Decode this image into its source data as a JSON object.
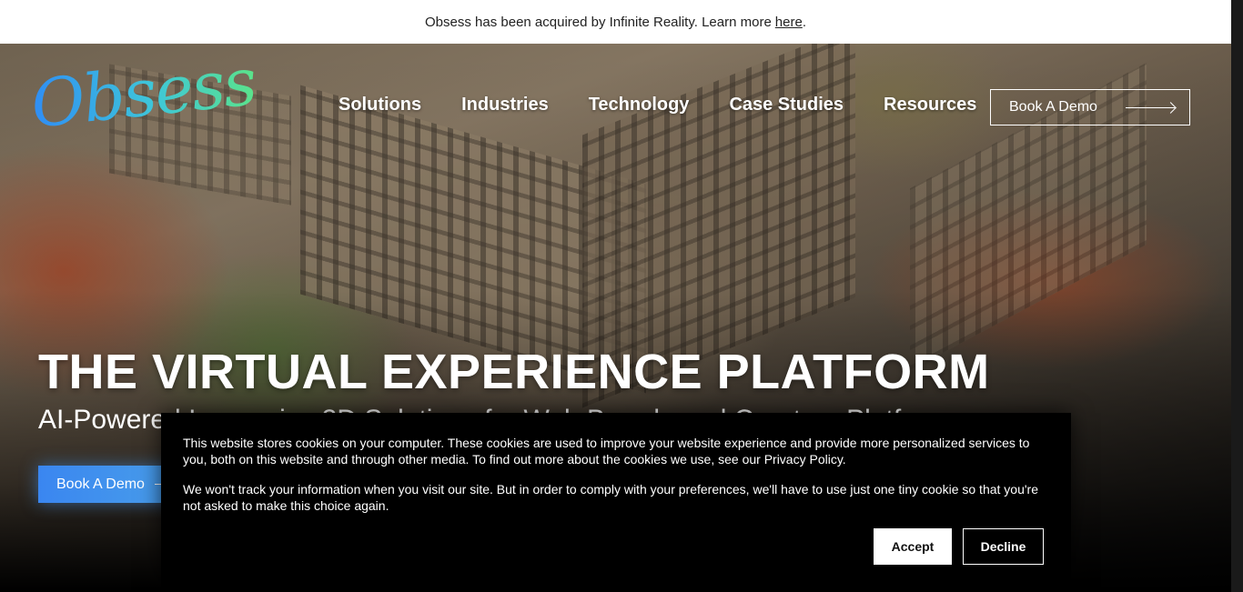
{
  "announcement": {
    "text": "Obsess has been acquired by Infinite Reality. Learn more",
    "link": "here",
    "suffix": "."
  },
  "header": {
    "logo": "Obsess",
    "nav": [
      "Solutions",
      "Industries",
      "Technology",
      "Case Studies",
      "Resources"
    ],
    "cta": "Book A Demo"
  },
  "hero": {
    "title": "THE VIRTUAL EXPERIENCE PLATFORM",
    "subtitle": "AI-Powered Immersive 3D Solutions for Web Brands and Creators Platform",
    "cta": "Book A Demo"
  },
  "cookie_banner": {
    "paragraph1": "This website stores cookies on your computer. These cookies are used to improve your website experience and provide more personalized services to you, both on this website and through other media. To find out more about the cookies we use, see our Privacy Policy.",
    "paragraph2": "We won't track your information when you visit our site. But in order to comply with your preferences, we'll have to use just one tiny cookie so that you're not asked to make this choice again.",
    "accept": "Accept",
    "decline": "Decline"
  },
  "colors": {
    "accent_blue": "#3a86f0",
    "logo_gradient_start": "#2f8df5",
    "logo_gradient_end": "#5be38a"
  },
  "icons": [
    "arrow-right-icon"
  ]
}
